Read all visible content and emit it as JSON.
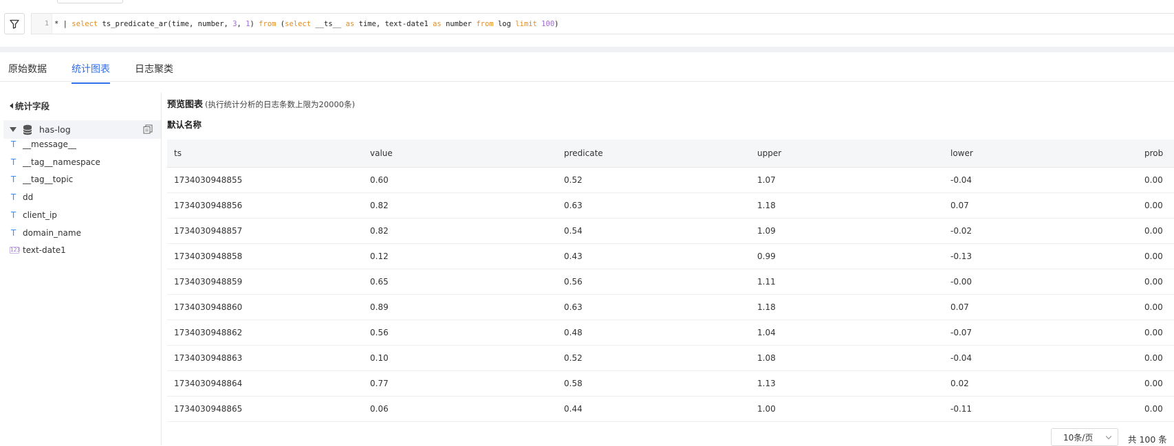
{
  "query": {
    "line_number": "1",
    "tokens": [
      {
        "t": "* | ",
        "c": "pipe"
      },
      {
        "t": "select",
        "c": "kw"
      },
      {
        "t": " ts_predicate_ar(time, number, ",
        "c": ""
      },
      {
        "t": "3",
        "c": "num"
      },
      {
        "t": ", ",
        "c": ""
      },
      {
        "t": "1",
        "c": "num"
      },
      {
        "t": ") ",
        "c": ""
      },
      {
        "t": "from",
        "c": "kw"
      },
      {
        "t": " (",
        "c": ""
      },
      {
        "t": "select",
        "c": "kw"
      },
      {
        "t": " __ts__ ",
        "c": ""
      },
      {
        "t": "as",
        "c": "kw"
      },
      {
        "t": " time, text-date1 ",
        "c": ""
      },
      {
        "t": "as",
        "c": "kw"
      },
      {
        "t": " number ",
        "c": ""
      },
      {
        "t": "from",
        "c": "kw"
      },
      {
        "t": " log ",
        "c": ""
      },
      {
        "t": "limit",
        "c": "kw"
      },
      {
        "t": " ",
        "c": ""
      },
      {
        "t": "100",
        "c": "num"
      },
      {
        "t": ")",
        "c": ""
      }
    ]
  },
  "tabs": [
    {
      "label": "原始数据",
      "active": false
    },
    {
      "label": "统计图表",
      "active": true
    },
    {
      "label": "日志聚类",
      "active": false
    }
  ],
  "sidebar": {
    "title": "统计字段",
    "logstore": "has-log",
    "fields": [
      {
        "name": "__message__",
        "type": "text"
      },
      {
        "name": "__tag__namespace",
        "type": "text"
      },
      {
        "name": "__tag__topic",
        "type": "text"
      },
      {
        "name": "dd",
        "type": "text"
      },
      {
        "name": "client_ip",
        "type": "text"
      },
      {
        "name": "domain_name",
        "type": "text"
      },
      {
        "name": "text-date1",
        "type": "number"
      }
    ]
  },
  "preview": {
    "title": "预览图表",
    "note": "(执行统计分析的日志条数上限为20000条)",
    "default_name": "默认名称"
  },
  "table": {
    "columns": [
      "ts",
      "value",
      "predicate",
      "upper",
      "lower",
      "prob"
    ],
    "rows": [
      [
        "1734030948855",
        "0.60",
        "0.52",
        "1.07",
        "-0.04",
        "0.00"
      ],
      [
        "1734030948856",
        "0.82",
        "0.63",
        "1.18",
        "0.07",
        "0.00"
      ],
      [
        "1734030948857",
        "0.82",
        "0.54",
        "1.09",
        "-0.02",
        "0.00"
      ],
      [
        "1734030948858",
        "0.12",
        "0.43",
        "0.99",
        "-0.13",
        "0.00"
      ],
      [
        "1734030948859",
        "0.65",
        "0.56",
        "1.11",
        "-0.00",
        "0.00"
      ],
      [
        "1734030948860",
        "0.89",
        "0.63",
        "1.18",
        "0.07",
        "0.00"
      ],
      [
        "1734030948862",
        "0.56",
        "0.48",
        "1.04",
        "-0.07",
        "0.00"
      ],
      [
        "1734030948863",
        "0.10",
        "0.52",
        "1.08",
        "-0.04",
        "0.00"
      ],
      [
        "1734030948864",
        "0.77",
        "0.58",
        "1.13",
        "0.02",
        "0.00"
      ],
      [
        "1734030948865",
        "0.06",
        "0.44",
        "1.00",
        "-0.11",
        "0.00"
      ]
    ]
  },
  "pagination": {
    "page_size": "10条/页",
    "total": "共 100 条"
  },
  "colors": {
    "accent": "#2f6fec",
    "keyword": "#e08e23",
    "number_literal": "#a06cd5",
    "text_field_icon": "#3d8bf0"
  }
}
